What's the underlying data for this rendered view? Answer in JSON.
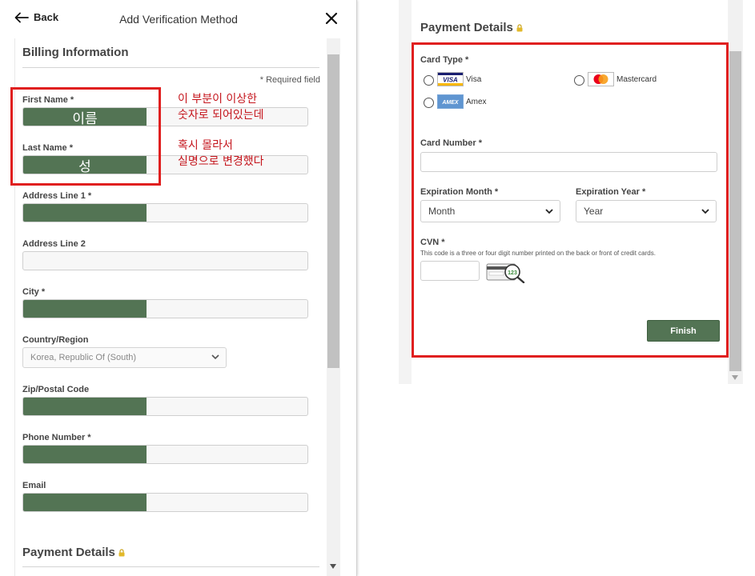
{
  "header": {
    "back_label": "Back",
    "title": "Add Verification Method"
  },
  "billing": {
    "title": "Billing Information",
    "required_note": "* Required field",
    "fields": {
      "first_name": {
        "label": "First Name *",
        "masked_text": "이름"
      },
      "last_name": {
        "label": "Last Name *",
        "masked_text": "성"
      },
      "address1": {
        "label": "Address Line 1 *"
      },
      "address2": {
        "label": "Address Line 2"
      },
      "city": {
        "label": "City *"
      },
      "country": {
        "label": "Country/Region",
        "value": "Korea, Republic Of (South)"
      },
      "zip": {
        "label": "Zip/Postal Code"
      },
      "phone": {
        "label": "Phone Number *"
      },
      "email": {
        "label": "Email"
      }
    },
    "mask_color": "#537454"
  },
  "annotation": {
    "line1": "이 부분이 이상한",
    "line2": "숫자로 되어있는데",
    "line3": "혹시 몰라서",
    "line4": "실명으로 변경했다",
    "color": "#c5161d",
    "box_color": "#e01f1f"
  },
  "payment": {
    "title": "Payment Details",
    "card_type_label": "Card Type *",
    "card_types": [
      {
        "name": "Visa",
        "logo_text": "VISA",
        "icon": "visa-logo-icon"
      },
      {
        "name": "Mastercard",
        "icon": "mastercard-logo-icon"
      },
      {
        "name": "Amex",
        "logo_text": "AMEX",
        "icon": "amex-logo-icon"
      }
    ],
    "card_number_label": "Card Number *",
    "exp_month_label": "Expiration Month *",
    "exp_month_value": "Month",
    "exp_year_label": "Expiration Year *",
    "exp_year_value": "Year",
    "cvn_label": "CVN *",
    "cvn_note": "This code is a three or four digit number printed on the back or front of credit cards.",
    "cvn_icon_text": "123",
    "finish_label": "Finish",
    "accent_color": "#537454"
  }
}
